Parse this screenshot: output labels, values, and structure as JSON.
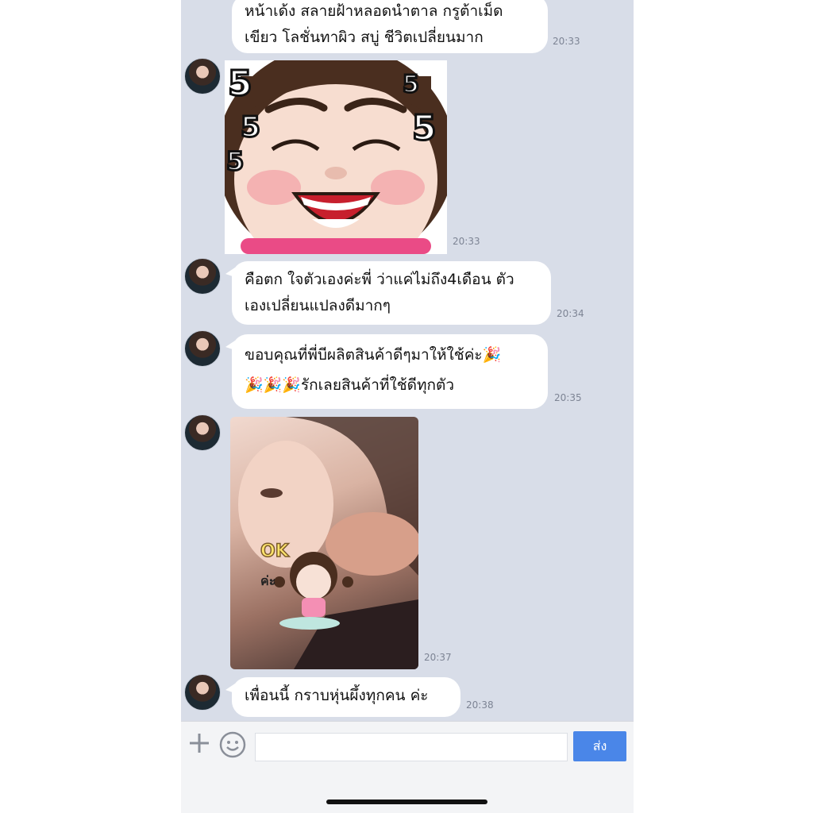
{
  "messages": [
    {
      "text": "หน้าเด้ง สลายฝ้าหลอดนำตาล กรูต้าเม็ด\nเขียว โลชั่นทาผิว สบู่ ชีวิตเปลี่ยนมาก",
      "time": "20:33"
    },
    {
      "sticker": "laughing-girl-sticker",
      "sticker_text": [
        "5",
        "5",
        "5",
        "5",
        "5"
      ],
      "time": "20:33"
    },
    {
      "text": "คือตก ใจตัวเองค่ะพี่ ว่าแค่ไม่ถึง4เดือน ตัว\nเองเปลี่ยนแปลงดีมากๆ",
      "time": "20:34"
    },
    {
      "text": "ขอบคุณที่พี่บีผลิตสินค้าดีๆมาให้ใช้ค่ะ🎉\n🎉🎉🎉รักเลยสินค้าที่ใช้ดีทุกตัว",
      "time": "20:35"
    },
    {
      "photo": "selfie-with-ok-sticker",
      "sticker_text": [
        "OK",
        "ค่ะ"
      ],
      "time": "20:37"
    },
    {
      "text": "เพื่อนนี้ กราบหุ่นผึ้งทุกคน ค่ะ",
      "time": "20:38"
    }
  ],
  "input": {
    "placeholder": "",
    "send_label": "ส่ง"
  },
  "colors": {
    "background": "#d8dde8",
    "bubble": "#ffffff",
    "send": "#4a86e8"
  }
}
